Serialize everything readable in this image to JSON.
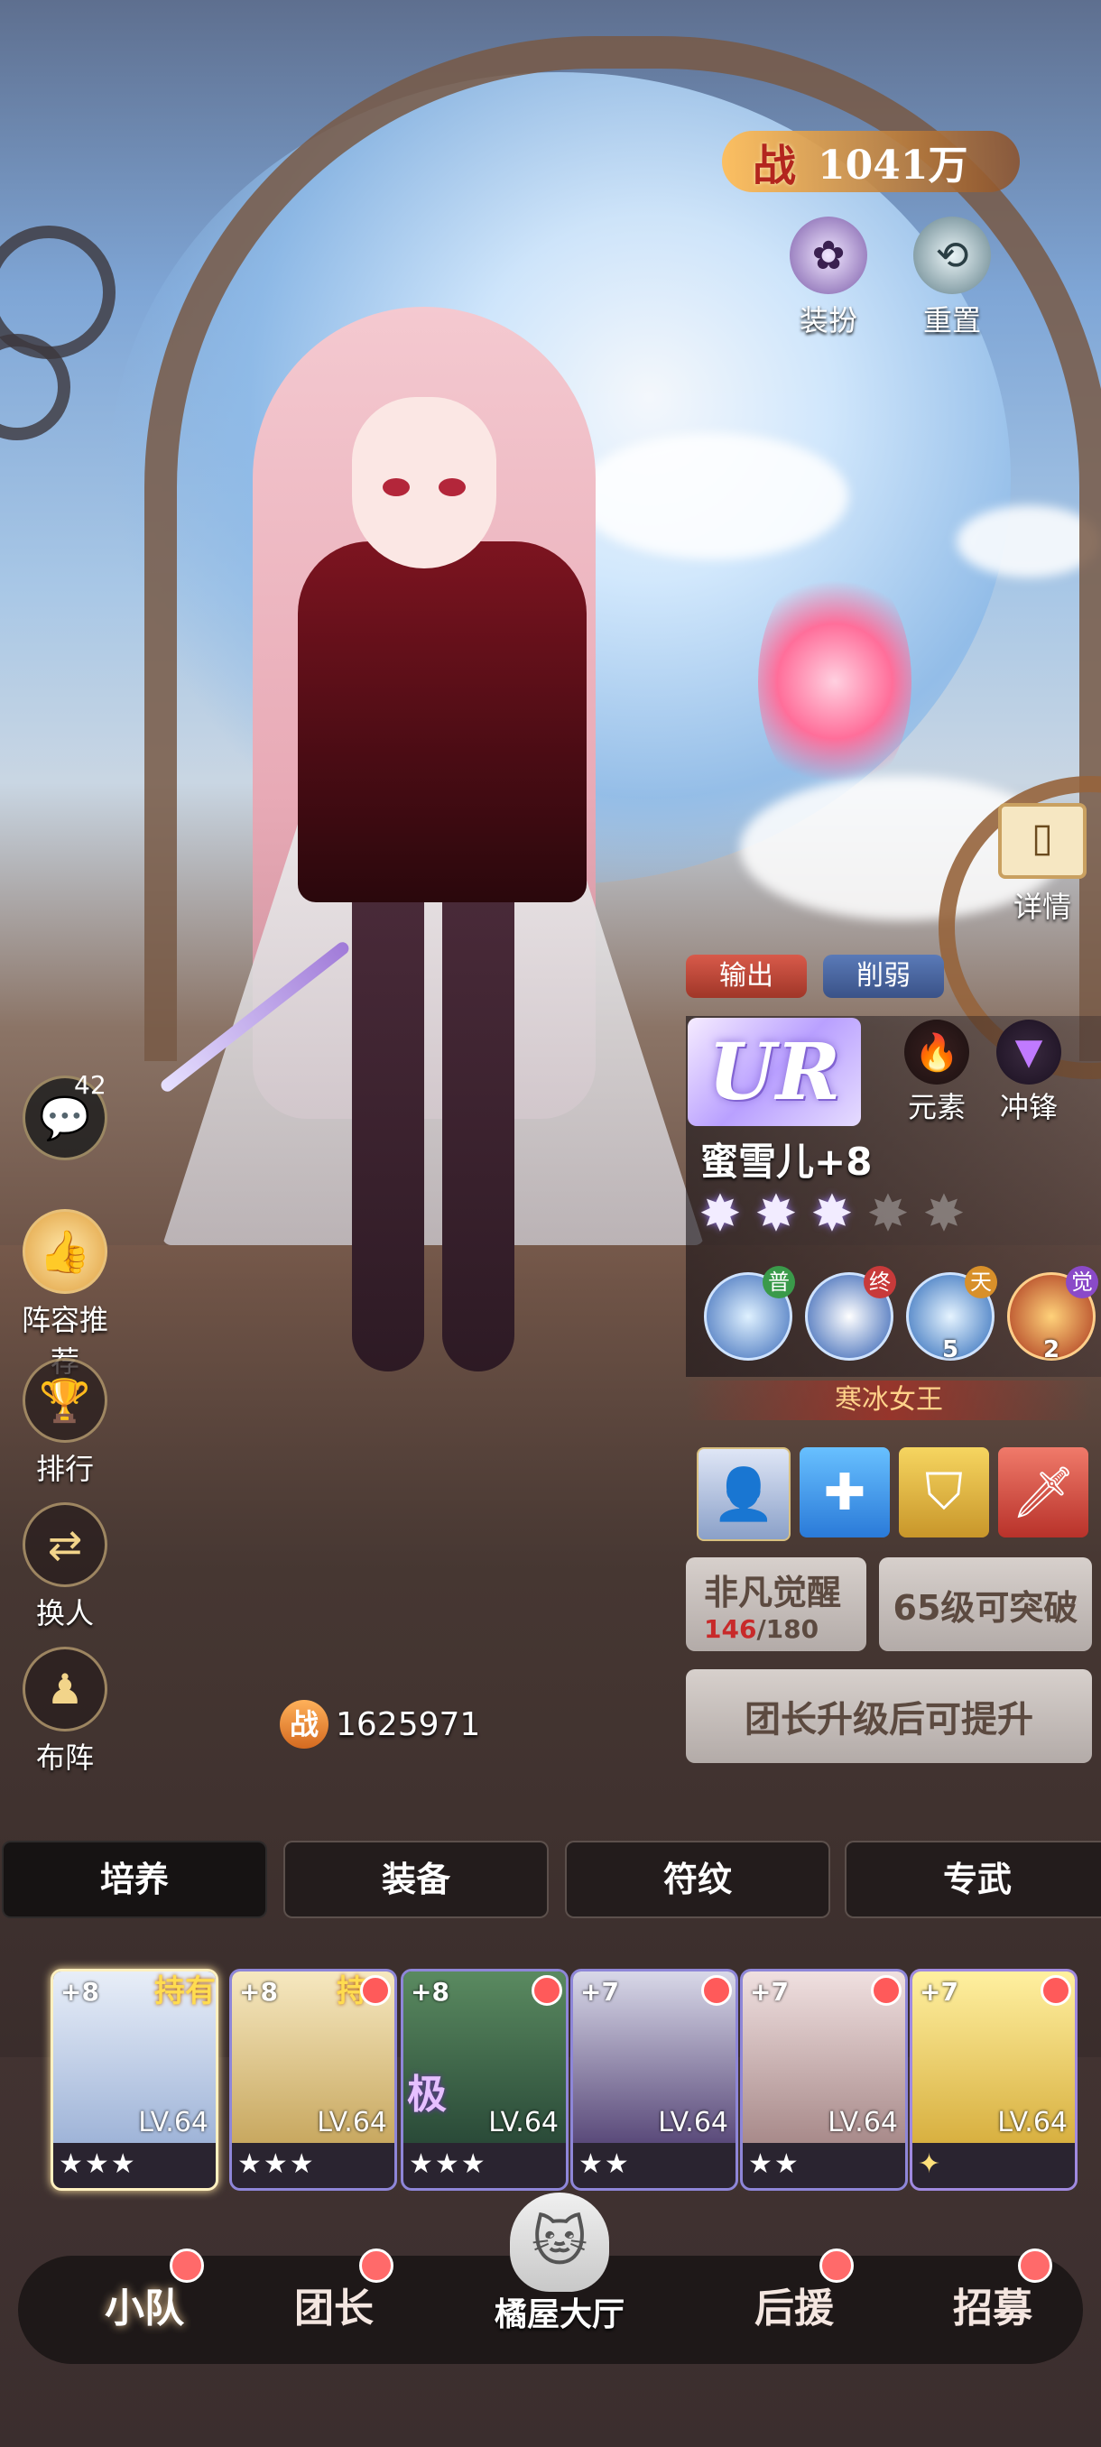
{
  "header": {
    "power_label": "战",
    "power_value": "1041万"
  },
  "top_buttons": [
    {
      "label": "装扮",
      "icon": "outfit-icon"
    },
    {
      "label": "重置",
      "icon": "reset-icon"
    }
  ],
  "detail": {
    "label": "详情",
    "icon": "book-icon"
  },
  "left_menu": {
    "chat_count": "42",
    "items": [
      {
        "label": "阵容推荐",
        "icon": "thumbs-up-icon"
      },
      {
        "label": "排行",
        "icon": "trophy-icon"
      },
      {
        "label": "换人",
        "icon": "swap-icon"
      },
      {
        "label": "布阵",
        "icon": "formation-icon"
      }
    ]
  },
  "hero": {
    "role_tags": [
      "输出",
      "削弱"
    ],
    "rarity": "UR",
    "element_label": "元素",
    "class_label": "冲锋",
    "name": "蜜雪儿+8",
    "stars_filled": 3,
    "stars_total": 5,
    "skills": [
      {
        "badge": "普",
        "badge_color": "#3a9a4a",
        "count": ""
      },
      {
        "badge": "终",
        "badge_color": "#c83a3a",
        "count": ""
      },
      {
        "badge": "天",
        "badge_color": "#d8902a",
        "count": "5"
      },
      {
        "badge": "觉",
        "badge_color": "#8a4ac8",
        "count": "2"
      }
    ],
    "title": "寒冰女王",
    "awaken_label": "非凡觉醒",
    "awaken_progress": "146",
    "awaken_total": "/180",
    "breakthrough_label": "65级可突破",
    "upgrade_label": "团长升级后可提升",
    "power_label": "战",
    "power_value": "1625971"
  },
  "tabs": [
    "培养",
    "装备",
    "符纹",
    "专武"
  ],
  "roster": [
    {
      "plus": "+8",
      "level": "LV.64",
      "stars": "★★★",
      "owned": "持有"
    },
    {
      "plus": "+8",
      "level": "LV.64",
      "stars": "★★★",
      "owned": "持"
    },
    {
      "plus": "+8",
      "level": "LV.64",
      "stars": "★★★",
      "tag": "极"
    },
    {
      "plus": "+7",
      "level": "LV.64",
      "stars": "★★"
    },
    {
      "plus": "+7",
      "level": "LV.64",
      "stars": "★★"
    },
    {
      "plus": "+7",
      "level": "LV.64",
      "stars": "✦"
    }
  ],
  "bottom_nav": [
    "小队",
    "团长",
    "橘屋大厅",
    "后援",
    "招募"
  ]
}
